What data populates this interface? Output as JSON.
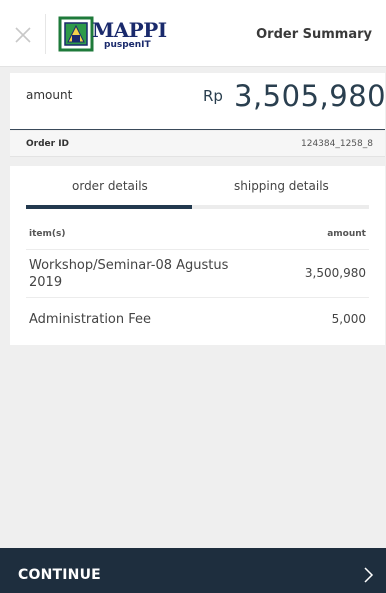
{
  "header": {
    "logo_text": "MAPPI",
    "logo_sub": "puspenIT",
    "title": "Order Summary"
  },
  "amount": {
    "label": "amount",
    "currency": "Rp",
    "value": "3,505,980"
  },
  "order": {
    "id_label": "Order ID",
    "id_value": "124384_1258_8"
  },
  "tabs": [
    {
      "label": "order details",
      "active": true
    },
    {
      "label": "shipping details",
      "active": false
    }
  ],
  "table": {
    "headers": {
      "item": "item(s)",
      "amount": "amount"
    },
    "rows": [
      {
        "name": "Workshop/Seminar-08 Agustus 2019",
        "amount": "3,500,980"
      },
      {
        "name": "Administration Fee",
        "amount": "5,000"
      }
    ]
  },
  "footer": {
    "label": "CONTINUE",
    "icon": "chevron-right-icon"
  },
  "colors": {
    "brand_dark": "#1e2e3e",
    "tab_active": "#22394e",
    "background": "#efefef"
  }
}
